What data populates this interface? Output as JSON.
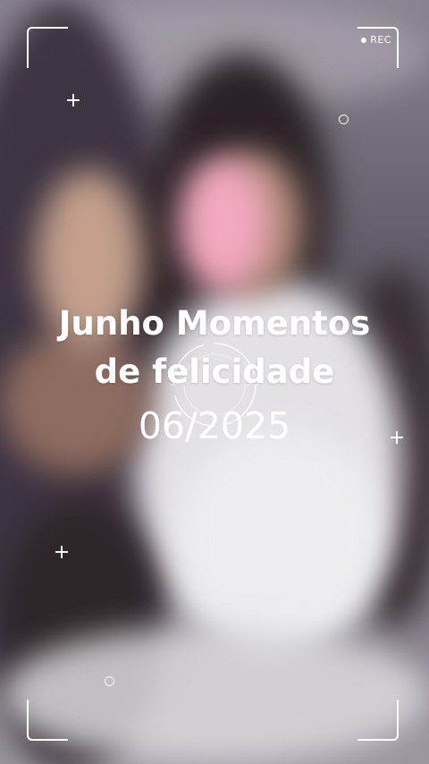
{
  "recorder": {
    "label": "REC"
  },
  "overlay": {
    "title_line1": "Junho Momentos",
    "title_line2": "de felicidade",
    "date": "06/2025"
  },
  "colors": {
    "overlay": "#ffffff"
  },
  "icons": [
    "rec-dot-icon",
    "plus-icon",
    "circle-icon",
    "focus-reticle-icon"
  ]
}
